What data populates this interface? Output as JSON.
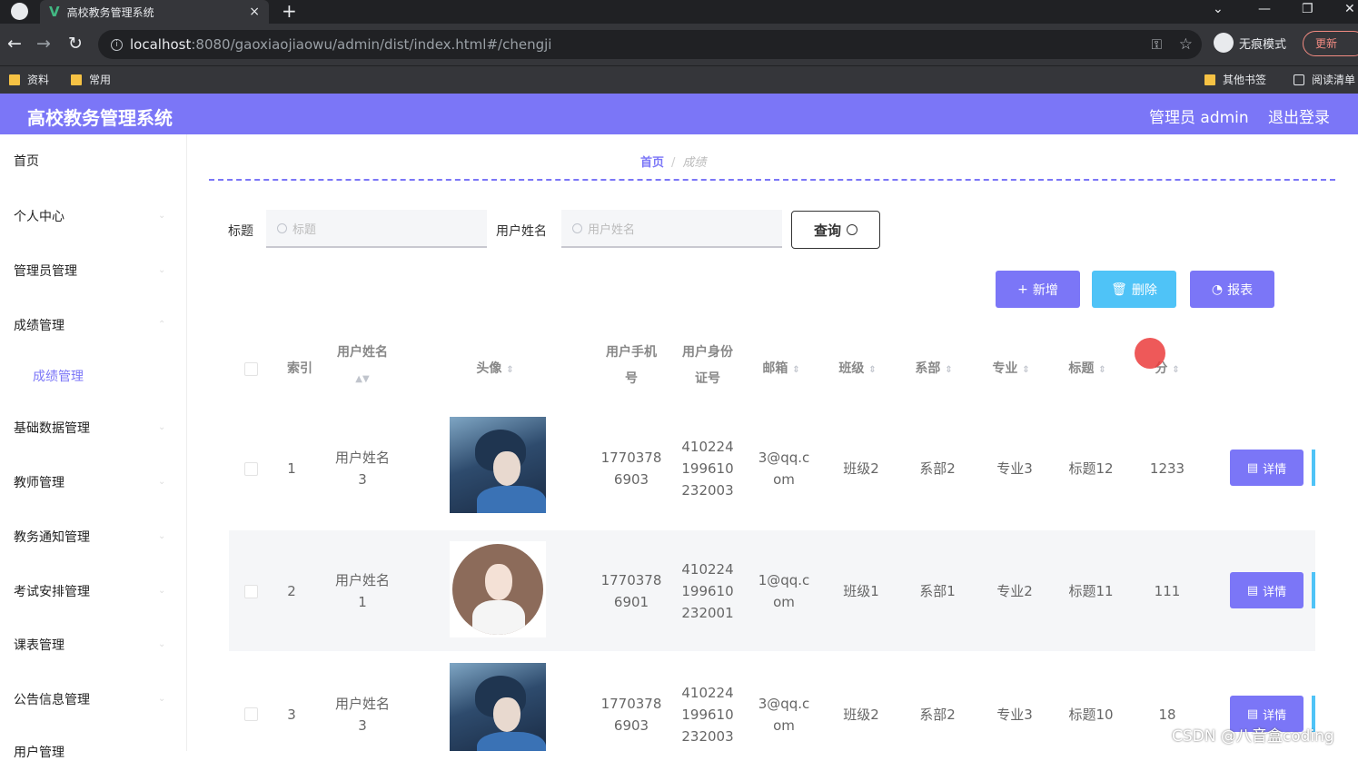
{
  "browser": {
    "tab_title": "高校教务管理系统",
    "tab_close": "×",
    "new_tab": "+",
    "url_host": "localhost",
    "url_rest": ":8080/gaoxiaojiaowu/admin/dist/index.html#/chengji",
    "incognito_label": "无痕模式",
    "update_label": "更新",
    "bookmarks": [
      "资料",
      "常用"
    ],
    "other_bookmarks": "其他书签",
    "reading_list": "阅读清单"
  },
  "app": {
    "title": "高校教务管理系统",
    "user_label": "管理员 admin",
    "logout_label": "退出登录",
    "accent_color": "#7b76f7"
  },
  "sidebar": {
    "items": [
      "首页",
      "个人中心",
      "管理员管理",
      "成绩管理",
      "成绩管理",
      "基础数据管理",
      "教师管理",
      "教务通知管理",
      "考试安排管理",
      "课表管理",
      "公告信息管理",
      "用户管理"
    ]
  },
  "breadcrumb": {
    "home": "首页",
    "current": "成绩"
  },
  "filters": {
    "title_label": "标题",
    "title_placeholder": "标题",
    "username_label": "用户姓名",
    "username_placeholder": "用户姓名",
    "query_label": "查询"
  },
  "actions": {
    "add": "新增",
    "delete": "删除",
    "report": "报表"
  },
  "table": {
    "headers": {
      "index": "索引",
      "username": "用户姓名",
      "avatar": "头像",
      "phone": "用户手机号",
      "idcard": "用户身份证号",
      "email": "邮箱",
      "class": "班级",
      "dept": "系部",
      "major": "专业",
      "title": "标题",
      "score": "分"
    },
    "rows": [
      {
        "index": "1",
        "username": "用户姓名3",
        "phone": "17703786903",
        "idcard": "410224199610232003",
        "email": "3@qq.com",
        "class": "班级2",
        "dept": "系部2",
        "major": "专业3",
        "title": "标题12",
        "score": "1233",
        "detail": "详情"
      },
      {
        "index": "2",
        "username": "用户姓名1",
        "phone": "17703786901",
        "idcard": "410224199610232001",
        "email": "1@qq.com",
        "class": "班级1",
        "dept": "系部1",
        "major": "专业2",
        "title": "标题11",
        "score": "111",
        "detail": "详情"
      },
      {
        "index": "3",
        "username": "用户姓名3",
        "phone": "17703786903",
        "idcard": "410224199610232003",
        "email": "3@qq.com",
        "class": "班级2",
        "dept": "系部2",
        "major": "专业3",
        "title": "标题10",
        "score": "18",
        "detail": "详情"
      }
    ]
  },
  "watermark": "CSDN @八音盒coding"
}
